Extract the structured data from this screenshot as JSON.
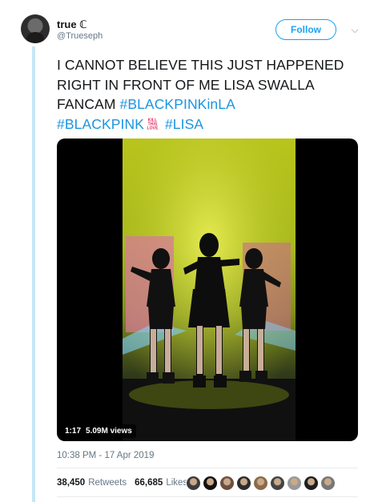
{
  "author": {
    "name": "true ℂ",
    "handle": "@Trueseph",
    "follow_label": "Follow",
    "avatar_icon": "avatar"
  },
  "tweet": {
    "text_main": "I CANNOT BELIEVE THIS JUST HAPPENED RIGHT IN FRONT OF ME LISA SWALLA FANCAM ",
    "hashtag_1": "#BLACKPINKinLA",
    "hashtag_2": "#BLACKPINK",
    "emoji_label": "KILL THIS LOVE",
    "hashtag_3": "#LISA"
  },
  "media": {
    "duration": "1:17",
    "views": "5.09M views"
  },
  "timestamp": "10:38 PM - 17 Apr 2019",
  "stats": {
    "retweets_count": "38,450",
    "retweets_label": "Retweets",
    "likes_count": "66,685",
    "likes_label": "Likes"
  },
  "colors": {
    "accent": "#1da1f2",
    "hashtag": "#1b95e0",
    "muted": "#657786",
    "thread_rule": "#c6e7f7"
  },
  "likers": [
    "#3b3b3b",
    "#111111",
    "#6b4f3f",
    "#2c2c2c",
    "#8a6a4a",
    "#444444",
    "#999999",
    "#1e1e1e",
    "#777777"
  ]
}
